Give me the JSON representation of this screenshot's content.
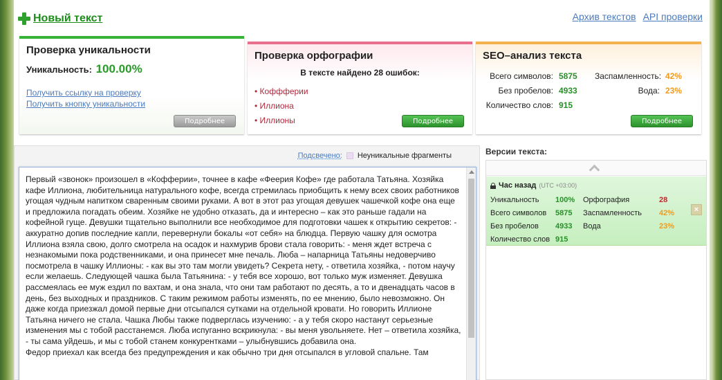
{
  "header": {
    "new_text": "Новый текст",
    "links": [
      "Архив текстов",
      "API проверки"
    ]
  },
  "uniqueness": {
    "title": "Проверка уникальности",
    "label": "Уникальность:",
    "value": "100.00%",
    "link1": "Получить ссылку на проверку",
    "link2": "Получить кнопку уникальности",
    "button": "Подробнее"
  },
  "spelling": {
    "title": "Проверка орфографии",
    "summary": "В тексте найдено 28 ошибок:",
    "errors": [
      "Коффферии",
      "Иллиона",
      "Иллионы"
    ],
    "button": "Подробнее"
  },
  "seo": {
    "title": "SEO–анализ текста",
    "left": [
      {
        "label": "Всего символов:",
        "value": "5875"
      },
      {
        "label": "Без пробелов:",
        "value": "4933"
      },
      {
        "label": "Количество слов:",
        "value": "915"
      }
    ],
    "right": [
      {
        "label": "Заспамленность:",
        "value": "42%"
      },
      {
        "label": "Вода:",
        "value": "23%"
      }
    ],
    "button": "Подробнее"
  },
  "editor": {
    "highlight_label": "Подсвечено:",
    "highlight_desc": "Неуникальные фрагменты",
    "text": "Первый «звонок» произошел в «Кофферии», точнее в кафе «Феерия Кофе» где работала Татьяна. Хозяйка кафе Иллиона, любительница натурального кофе, всегда стремилась приобщить к нему всех своих работников угощая чудным напитком сваренным своими руками. А вот в этот раз угощая девушек чашечкой кофе она еще и предложила погадать обеим. Хозяйке не удобно отказать, да и интересно – как это раньше гадали на кофейной гуще. Девушки тщательно выполнили все необходимое для подготовки чашек к открытию секретов: - аккуратно допив последние капли, перевернули бокалы «от себя» на блюдца. Первую чашку для осмотра Иллиона взяла свою, долго смотрела на осадок и нахмурив брови стала говорить: - меня ждет встреча с незнакомыми пока родственниками, и она принесет мне печаль. Люба – напарница Татьяны недоверчиво посмотрела в чашку Иллионы: - как вы это там могли увидеть? Секрета нету, - ответила хозяйка, - потом научу если желаешь. Следующей чашка была Татьянина: - у тебя все хорошо, вот только муж изменяет. Девушка рассмеялась ее муж ездил по вахтам, и она знала, что они там работают по десять, а то и двенадцать часов в день, без выходных и праздников. С таким режимом работы изменять, по ее мнению, было невозможно. Он даже когда приезжал домой первые дни отсыпался сутками на отдельной кровати. Но говорить Иллионе Татьяна ничего не стала. Чашка Любы также подверглась изучению: - а у тебя скоро настанут серьезные изменения мы с тобой расстанемся. Люба испуганно вскрикнула: - вы меня увольняете. Нет – ответила хозяйка, - ты сама уйдешь, и мы с тобой станем конкурентками – улыбнувшись добавила она.",
    "text2": "Федор приехал как всегда без предупреждения и как обычно три дня отсыпался в угловой спальне. Там"
  },
  "versions": {
    "title": "Версии текста:",
    "item": {
      "time": "Час назад",
      "tz": "(UTC +03:00)",
      "left": [
        {
          "label": "Уникальность",
          "value": "100%"
        },
        {
          "label": "Всего символов",
          "value": "5875"
        },
        {
          "label": "Без пробелов",
          "value": "4933"
        },
        {
          "label": "Количество слов",
          "value": "915"
        }
      ],
      "right": [
        {
          "label": "Орфография",
          "value": "28"
        },
        {
          "label": "Заспамленность",
          "value": "42%"
        },
        {
          "label": "Вода",
          "value": "23%"
        }
      ],
      "close": "×"
    }
  },
  "colors": {
    "accent_green": "#37b238",
    "spelling_pink": "#e86f8e",
    "seo_orange": "#f4b24d",
    "error_red": "#b0283c"
  }
}
